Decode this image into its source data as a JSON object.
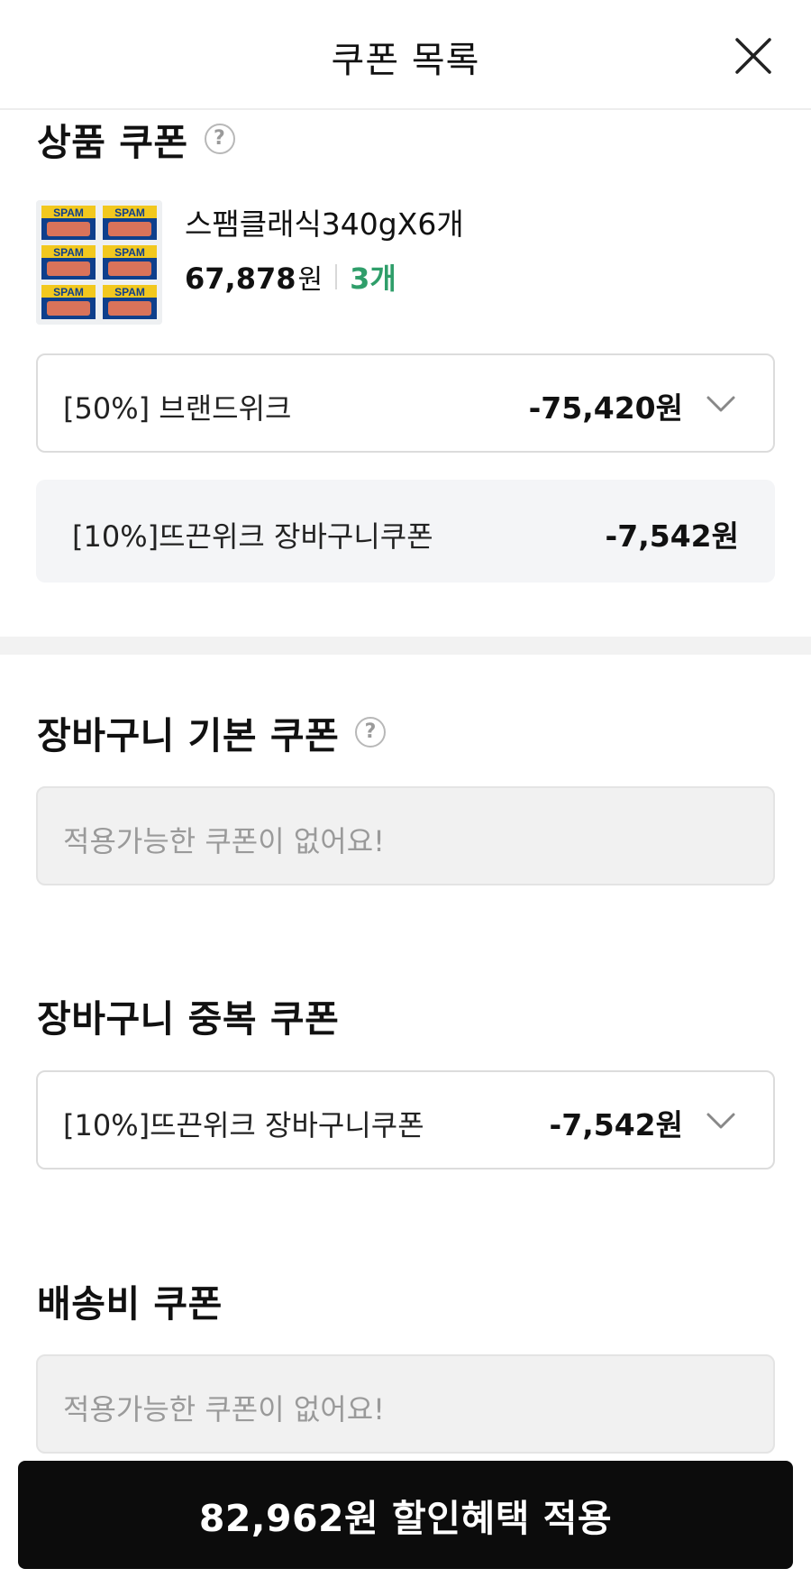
{
  "header": {
    "title": "쿠폰 목록",
    "close_icon": "close-icon"
  },
  "product_coupon": {
    "title": "상품 쿠폰",
    "help_icon": "question-circle-icon",
    "product": {
      "thumbnail_label": "SPAM",
      "name": "스팸클래식340gX6개",
      "price": "67,878",
      "currency": "원",
      "quantity": "3개"
    },
    "selected": {
      "name": "[50%] 브랜드위크",
      "amount": "-75,420원"
    },
    "alternative": {
      "name": "[10%]뜨끈위크 장바구니쿠폰",
      "amount": "-7,542원"
    }
  },
  "cart_basic_coupon": {
    "title": "장바구니 기본 쿠폰",
    "help_icon": "question-circle-icon",
    "empty_message": "적용가능한 쿠폰이 없어요!"
  },
  "cart_stack_coupon": {
    "title": "장바구니 중복 쿠폰",
    "selected": {
      "name": "[10%]뜨끈위크 장바구니쿠폰",
      "amount": "-7,542원"
    }
  },
  "shipping_coupon": {
    "title": "배송비 쿠폰",
    "empty_message": "적용가능한 쿠폰이 없어요!"
  },
  "apply_button": {
    "label": "82,962원 할인혜택 적용"
  },
  "colors": {
    "qty_green": "#2f9e6a",
    "cta_bg": "#0c0c0c",
    "sub_bg": "#f4f5f7",
    "empty_bg": "#f1f1f1"
  }
}
